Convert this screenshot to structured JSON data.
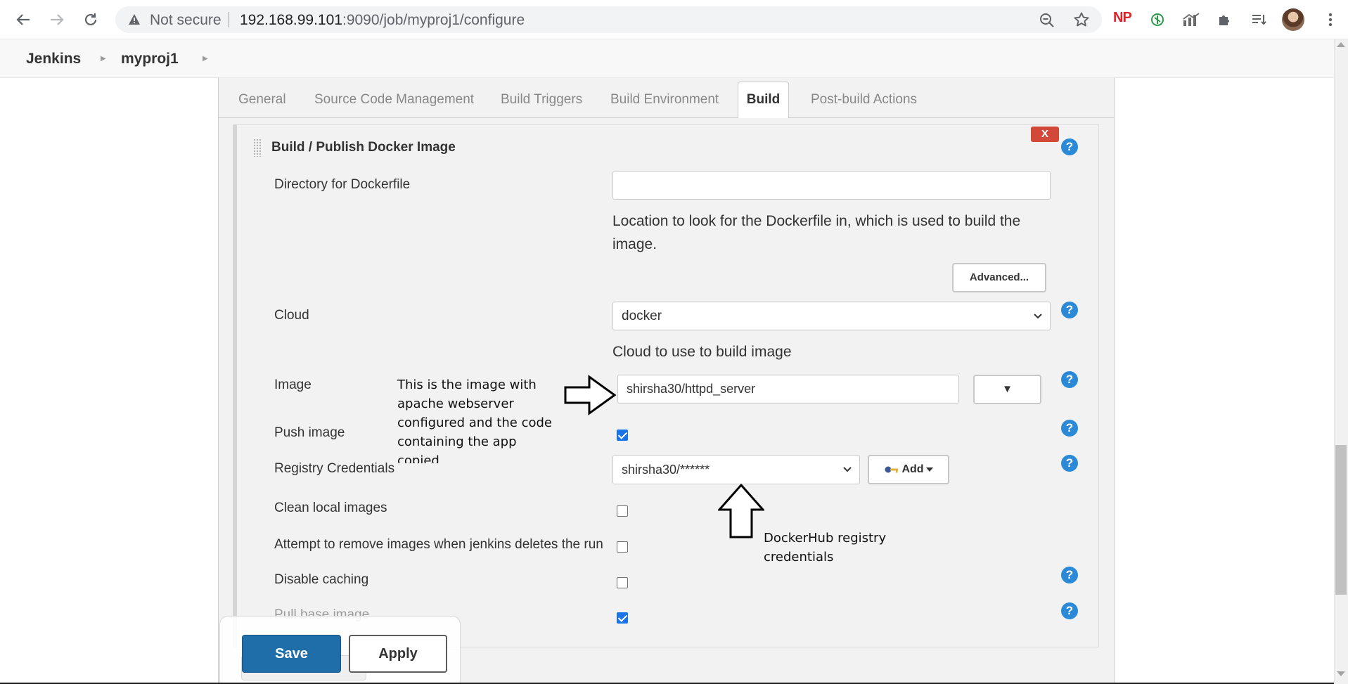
{
  "browser": {
    "security_label": "Not secure",
    "url_host": "192.168.99.101",
    "url_rest": ":9090/job/myproj1/configure",
    "extension_np_label": "NP"
  },
  "breadcrumb": {
    "items": [
      "Jenkins",
      "myproj1"
    ]
  },
  "tabs": {
    "items": [
      "General",
      "Source Code Management",
      "Build Triggers",
      "Build Environment",
      "Build",
      "Post-build Actions"
    ],
    "active": "Build"
  },
  "section": {
    "title": "Build / Publish Docker Image",
    "delete_label": "X",
    "help_glyph": "?"
  },
  "fields": {
    "directory": {
      "label": "Directory for Dockerfile",
      "value": "",
      "help": "Location to look for the Dockerfile in, which is used to build the image."
    },
    "advanced_label": "Advanced...",
    "cloud": {
      "label": "Cloud",
      "value": "docker",
      "help": "Cloud to use to build image"
    },
    "image": {
      "label": "Image",
      "value": "shirsha30/httpd_server",
      "dropdown_glyph": "▼"
    },
    "push_image": {
      "label": "Push image",
      "checked": true
    },
    "registry": {
      "label": "Registry Credentials",
      "value": "shirsha30/******",
      "add_label": "Add"
    },
    "clean_local": {
      "label": "Clean local images",
      "checked": false
    },
    "remove_images": {
      "label": "Attempt to remove images when jenkins deletes the run",
      "checked": false
    },
    "disable_caching": {
      "label": "Disable caching",
      "checked": false
    },
    "pull_base": {
      "label": "Pull base image",
      "checked": true
    }
  },
  "annotations": {
    "image_note": [
      "This is the image with",
      "apache webserver",
      "configured and the code",
      "containing the app",
      "copied"
    ],
    "registry_note": [
      "DockerHub registry",
      "credentials"
    ]
  },
  "actions": {
    "save_label": "Save",
    "apply_label": "Apply"
  },
  "colors": {
    "save_button": "#1f6ea9",
    "help_icon": "#2b8ad8",
    "delete_button": "#d24939",
    "checkbox_checked": "#1a73e8"
  }
}
